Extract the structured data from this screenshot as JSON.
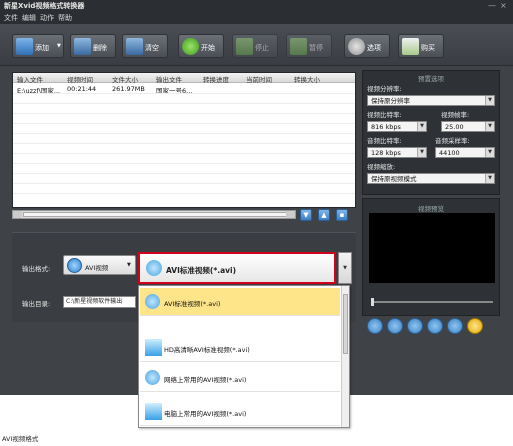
{
  "window": {
    "title": "新星Xvid视频格式转换器",
    "controls": [
      "—",
      "×"
    ]
  },
  "menu": [
    "文件",
    "编辑",
    "动作",
    "帮助"
  ],
  "toolbar": {
    "add": "添加",
    "delete": "删除",
    "clear": "清空",
    "start": "开始",
    "stop": "停止",
    "pause": "暂停",
    "options": "选项",
    "buy": "购买"
  },
  "file_table": {
    "headers": [
      "输入文件",
      "视频时间",
      "文件大小",
      "输出文件",
      "转换进度",
      "当前时间",
      "转换大小"
    ],
    "rows": [
      {
        "input": "E:\\uzzf\\国家...",
        "duration": "00:21:44",
        "size": "261.97MB",
        "output": "国家一号6..."
      }
    ]
  },
  "settings": {
    "section_title": "预置选项",
    "resolution_label": "视频分辨率:",
    "resolution_value": "保持原分辨率",
    "video_bitrate_label": "视频比特率:",
    "video_bitrate_value": "816 kbps",
    "framerate_label": "视频帧率:",
    "framerate_value": "25.00",
    "audio_bitrate_label": "音频比特率:",
    "audio_bitrate_value": "128 kbps",
    "samplerate_label": "音频采样率:",
    "samplerate_value": "44100",
    "scale_label": "视频缩放:",
    "scale_value": "保持原视频模式"
  },
  "preview": {
    "section_title": "视频预览"
  },
  "output": {
    "format_label": "输出格式:",
    "format_category": "AVI视频",
    "format_selected": "AVI标准视频(*.avi)",
    "dir_label": "输出目录:",
    "dir_value": "C:\\新星视频软件输出"
  },
  "format_options": [
    "AVI标准视频(*.avi)",
    "HD高清晰AVI标准视频(*.avi)",
    "网络上常用的AVI视频(*.avi)",
    "电脑上常用的AVI视频(*.avi)"
  ],
  "footer": {
    "text": "AVI视频格式"
  },
  "colors": {
    "accent_red": "#d0021b",
    "selected_option": "#ffe58a",
    "app_bg": "#3f4348"
  }
}
